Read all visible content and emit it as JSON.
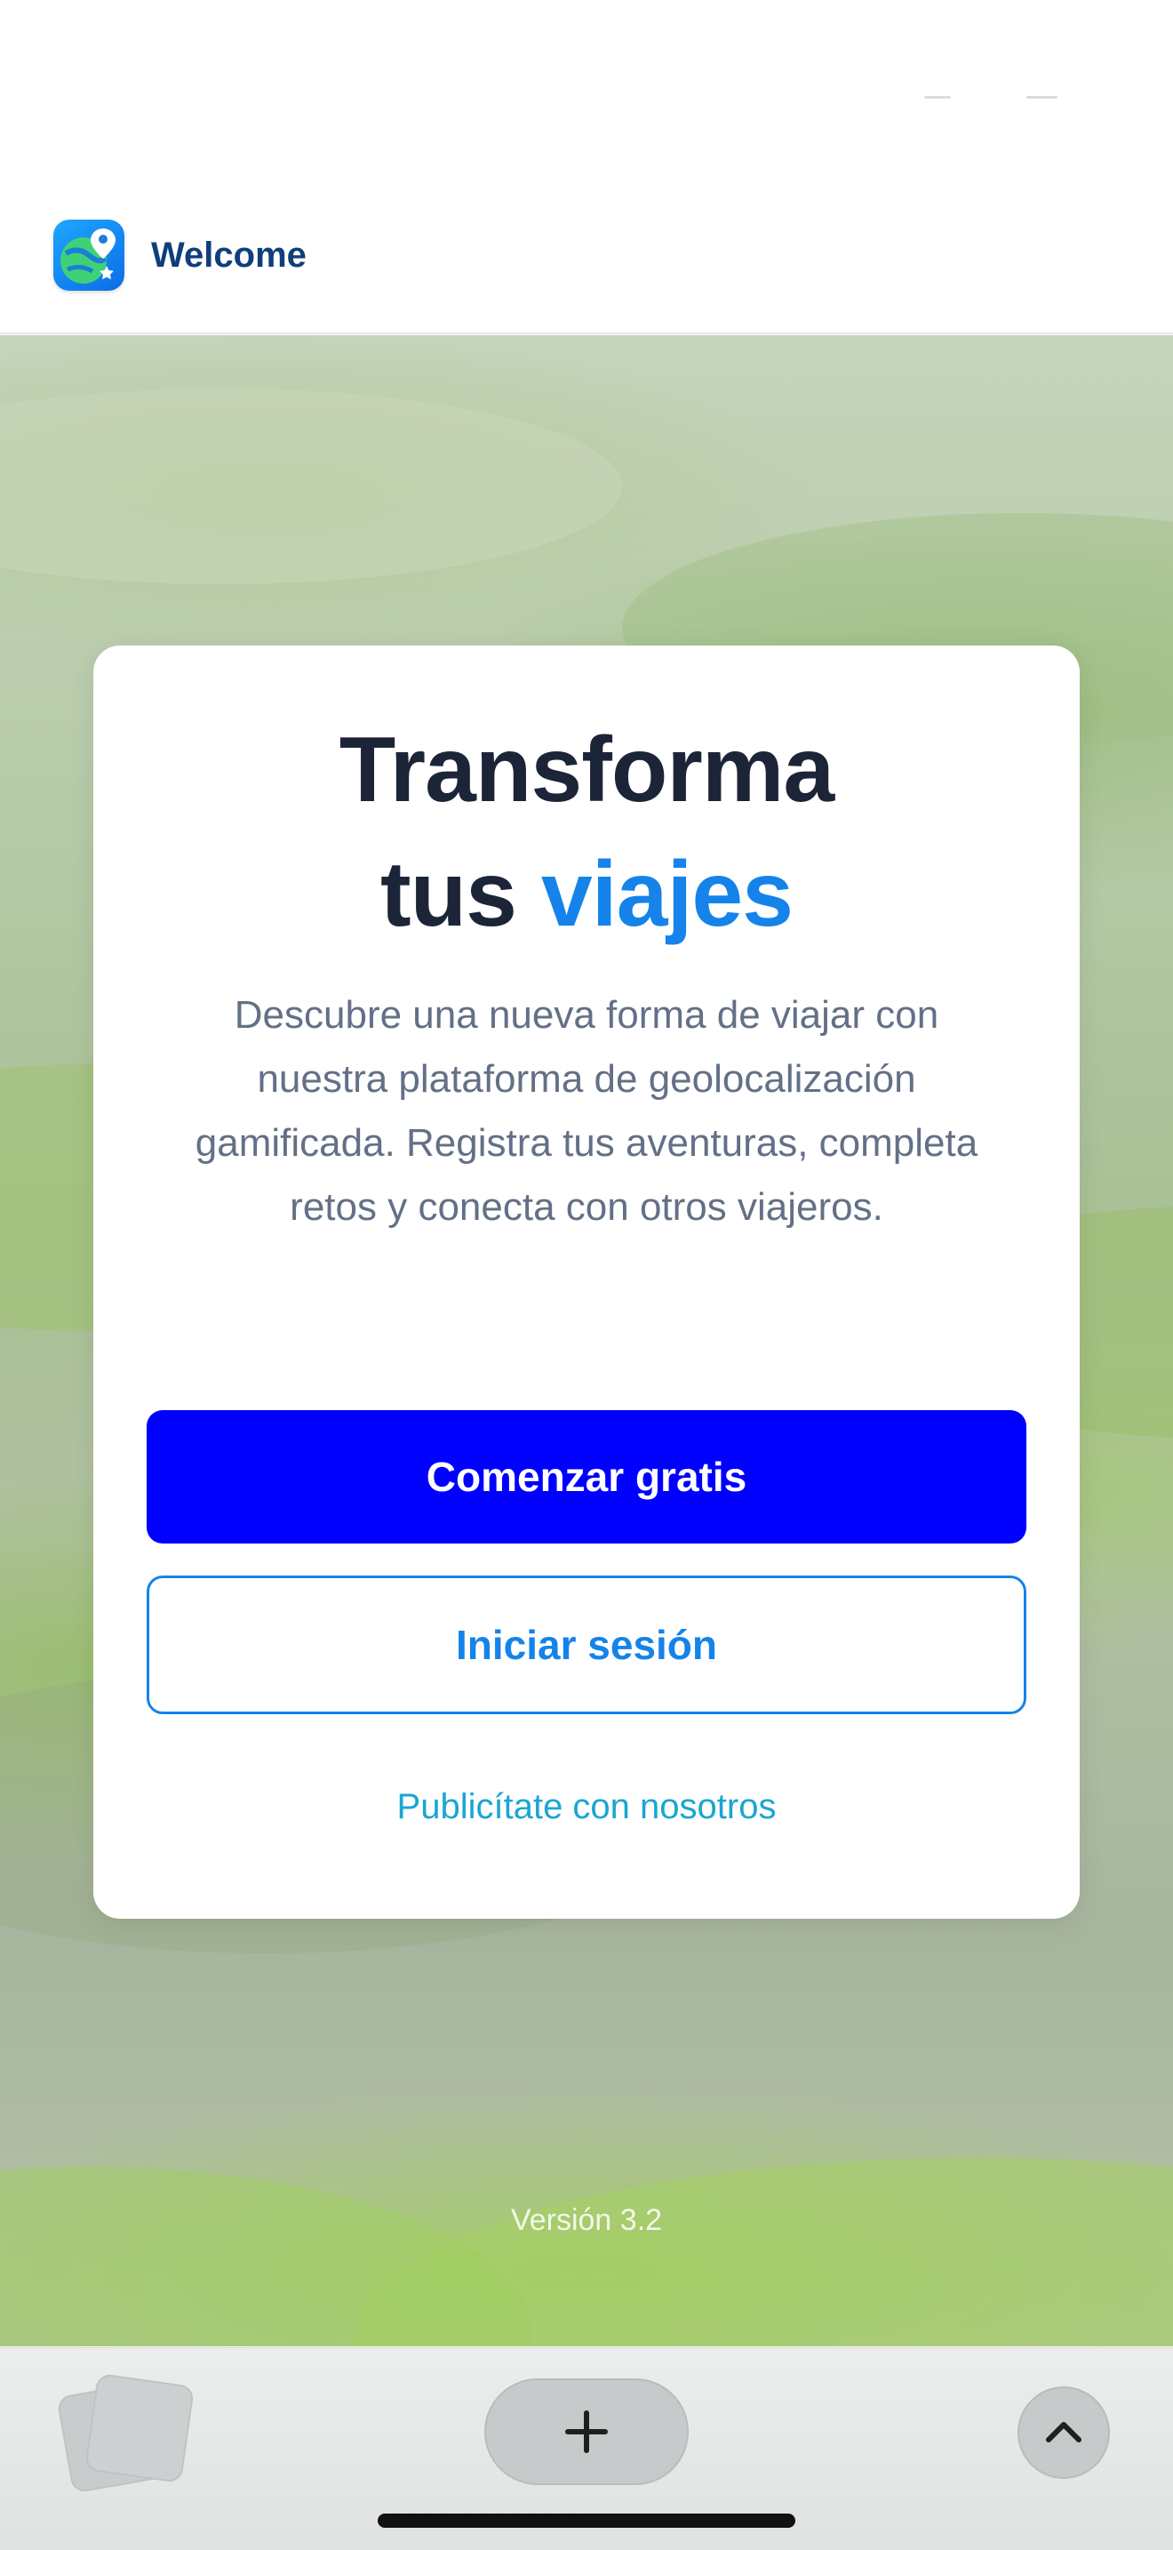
{
  "header": {
    "app_icon": "globe-map-pin-app-icon",
    "title": "Welcome"
  },
  "card": {
    "headline_line1": "Transforma",
    "headline_line2_plain": "tus",
    "headline_line2_accent": "viajes",
    "description": "Descubre una nueva forma de viajar con nuestra plataforma de geolocalización gamificada. Registra tus aventuras, completa retos y conecta con otros viajeros.",
    "primary_button": "Comenzar gratis",
    "secondary_button": "Iniciar sesión",
    "advertise_link": "Publicítate con nosotros"
  },
  "footer": {
    "version": "Versión 3.2"
  },
  "browser_toolbar": {
    "tabs_icon": "tabs-icon",
    "new_tab_icon": "plus-icon",
    "expand_icon": "chevron-up-icon"
  },
  "colors": {
    "primary_button": "#0000ff",
    "accent_blue": "#1583ea",
    "headline": "#1c2538",
    "description": "#637086",
    "link": "#1aa6d1",
    "header_title": "#0f3f7a"
  }
}
